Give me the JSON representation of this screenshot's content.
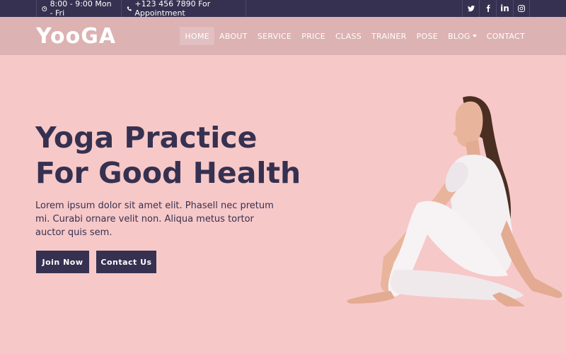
{
  "topbar": {
    "hours": "8:00 - 9:00 Mon - Fri",
    "phone": "+123 456 7890 For Appointment",
    "social": [
      {
        "icon": "twitter-icon"
      },
      {
        "icon": "facebook-icon"
      },
      {
        "icon": "linkedin-icon",
        "text": "in"
      },
      {
        "icon": "instagram-icon"
      }
    ]
  },
  "navbar": {
    "logo": "YooGA",
    "menu": [
      {
        "label": "HOME",
        "active": true
      },
      {
        "label": "ABOUT"
      },
      {
        "label": "SERVICE"
      },
      {
        "label": "PRICE"
      },
      {
        "label": "CLASS"
      },
      {
        "label": "TRAINER"
      },
      {
        "label": "POSE"
      },
      {
        "label": "BLOG",
        "dropdown": true
      },
      {
        "label": "CONTACT"
      }
    ]
  },
  "hero": {
    "title_line1": "Yoga Practice",
    "title_line2": "For Good Health",
    "text": "Lorem ipsum dolor sit amet elit. Phasell nec pretum mi. Curabi ornare velit non. Aliqua metus tortor auctor quis sem.",
    "join_label": "Join Now",
    "contact_label": "Contact Us"
  },
  "colors": {
    "background": "#f7c8c8",
    "navbar": "#dcb2b3",
    "dark": "#363150",
    "white": "#ffffff"
  }
}
